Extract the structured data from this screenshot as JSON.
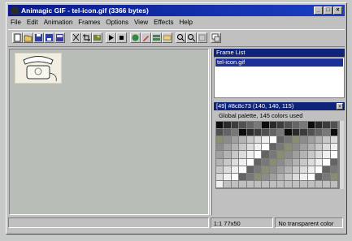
{
  "window": {
    "title": "Animagic GIF - tel-icon.gif  (3366 bytes)"
  },
  "menu": [
    "File",
    "Edit",
    "Animation",
    "Frames",
    "Options",
    "View",
    "Effects",
    "Help"
  ],
  "toolbar": {
    "icons": [
      "new-file-icon",
      "open-file-icon",
      "save-icon",
      "save-as-icon",
      "save-all-icon",
      "cut-icon",
      "crop-icon",
      "image-icon",
      "play-icon",
      "stop-icon",
      "effects-icon",
      "pen-icon",
      "frames-icon",
      "zoom-in-icon",
      "zoom-out-icon",
      "zoom-box-icon",
      "properties-icon"
    ]
  },
  "frame_list": {
    "header": "Frame List",
    "items": [
      "tel-icon.gif"
    ]
  },
  "palette": {
    "header": "[49] #8c8c73 (140, 140, 115)",
    "info": "Global palette, 145 colors used"
  },
  "status": {
    "frame": "1:1  77x50",
    "transparency": "No transparent color"
  },
  "colors": {
    "title_bar": "#10237a",
    "selection": "#1c2f96",
    "workspace": "#b9bdb7"
  }
}
